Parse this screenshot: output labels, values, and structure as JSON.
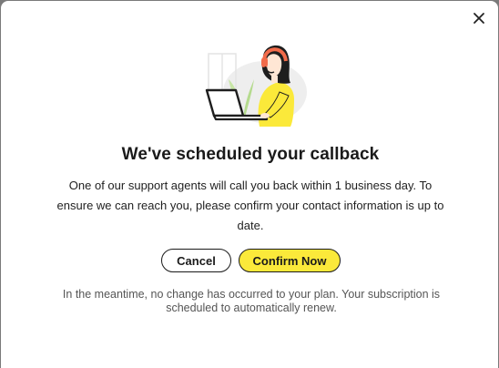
{
  "dialog": {
    "title": "We've scheduled your callback",
    "body": "One of our support agents will call you back within 1 business day. To ensure we can reach you, please confirm your contact information is up to date.",
    "cancel_label": "Cancel",
    "confirm_label": "Confirm Now",
    "footnote": "In the meantime, no change has occurred to your plan. Your subscription is scheduled to automatically renew.",
    "close_icon": "close-icon",
    "illustration_icon": "support-agent-illustration"
  },
  "colors": {
    "accent": "#fbe93a",
    "headset": "#f26b4a",
    "text": "#1a1a1a",
    "muted": "#555555"
  }
}
